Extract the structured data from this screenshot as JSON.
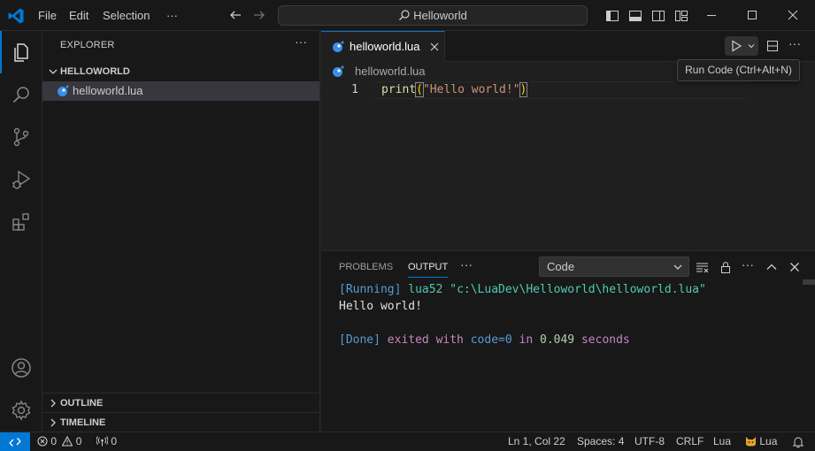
{
  "titlebar": {
    "menu": [
      "File",
      "Edit",
      "Selection"
    ],
    "more": "···",
    "search_text": "Helloworld"
  },
  "sidebar": {
    "header": "EXPLORER",
    "more": "···",
    "folder": "HELLOWORLD",
    "file": "helloworld.lua",
    "outline": "OUTLINE",
    "timeline": "TIMELINE"
  },
  "editor": {
    "tab_label": "helloworld.lua",
    "breadcrumb": "helloworld.lua",
    "more": "···",
    "lines": [
      {
        "number": "1",
        "fn": "print",
        "open": "(",
        "str": "\"Hello world!\"",
        "close": ")"
      }
    ],
    "tooltip": "Run Code (Ctrl+Alt+N)"
  },
  "panel": {
    "tabs": [
      "PROBLEMS",
      "OUTPUT"
    ],
    "more": "···",
    "select_value": "Code",
    "output": {
      "running_tag": "[Running]",
      "running_cmd": " lua52 \"c:\\LuaDev\\Helloworld\\helloworld.lua\"",
      "result": "Hello world!",
      "done_tag": "[Done]",
      "done_exited": " exited with ",
      "done_code": "code=0",
      "done_in": " in ",
      "done_time": "0.049",
      "done_seconds": " seconds"
    }
  },
  "statusbar": {
    "errors": "0",
    "warnings": "0",
    "ports": "0",
    "position": "Ln 1, Col 22",
    "spaces": "Spaces: 4",
    "encoding": "UTF-8",
    "eol": "CRLF",
    "language": "Lua",
    "extension": "Lua"
  },
  "colors": {
    "accent": "#0078d4",
    "background": "#1f1f1f",
    "chrome": "#181818",
    "lua_icon": "#3b8eea"
  }
}
